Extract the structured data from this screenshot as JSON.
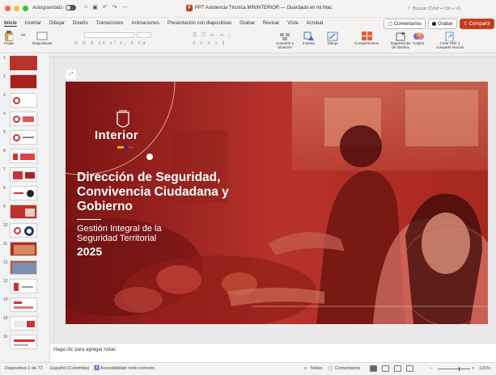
{
  "window": {
    "autosave_label": "Autoguardado",
    "title": "PPT Asistencia Técnica MININTERIOR — Guardado en mi Mac",
    "app_badge": "P",
    "search_placeholder": "Buscar (Cmd + Ctrl + U)"
  },
  "ribbon_tabs": [
    "Inicio",
    "Insertar",
    "Dibujar",
    "Diseño",
    "Transiciones",
    "Animaciones",
    "Presentación con diapositivas",
    "Grabar",
    "Revisar",
    "Vista",
    "Acrobat"
  ],
  "ribbon_right": {
    "comments": "Comentarios",
    "record": "Grabar",
    "share": "Compartir"
  },
  "ribbon_buttons": {
    "paste": "Pegar",
    "slides": "Diapositivas",
    "convert_smartart": "Convertir a SmartArt",
    "insert": "Insertar",
    "draw": "Dibujo",
    "addins": "Complementos",
    "design_suggestions": "Sugerencias de diseños",
    "copilot": "Copilot",
    "create_pdf": "Crear PDF y compartir vínculo"
  },
  "thumbnails": [
    {
      "n": "1",
      "selected": true
    },
    {
      "n": "2"
    },
    {
      "n": "3"
    },
    {
      "n": "4"
    },
    {
      "n": "5"
    },
    {
      "n": "6"
    },
    {
      "n": "7"
    },
    {
      "n": "8"
    },
    {
      "n": "9"
    },
    {
      "n": "10"
    },
    {
      "n": "11"
    },
    {
      "n": "12"
    },
    {
      "n": "13"
    },
    {
      "n": "14"
    },
    {
      "n": "15"
    },
    {
      "n": "16"
    }
  ],
  "slide": {
    "logo_text": "Interior",
    "heading_line1": "Dirección de Seguridad,",
    "heading_line2": "Convivencia Ciudadana y",
    "heading_line3": "Gobierno",
    "subtitle_line1": "Gestión Integral de la",
    "subtitle_line2": "Seguridad Territorial",
    "year": "2025"
  },
  "notes_placeholder": "Haga clic para agregar notas",
  "status": {
    "slide_count": "Diapositiva 1 de 72",
    "language": "Español (Colombia)",
    "accessibility": "Accesibilidad: todo correcto",
    "notes": "Notas",
    "comments": "Comentarios",
    "zoom": "131%"
  },
  "colors": {
    "accent": "#c43e1c",
    "slide_overlay": "#b01d1d"
  }
}
